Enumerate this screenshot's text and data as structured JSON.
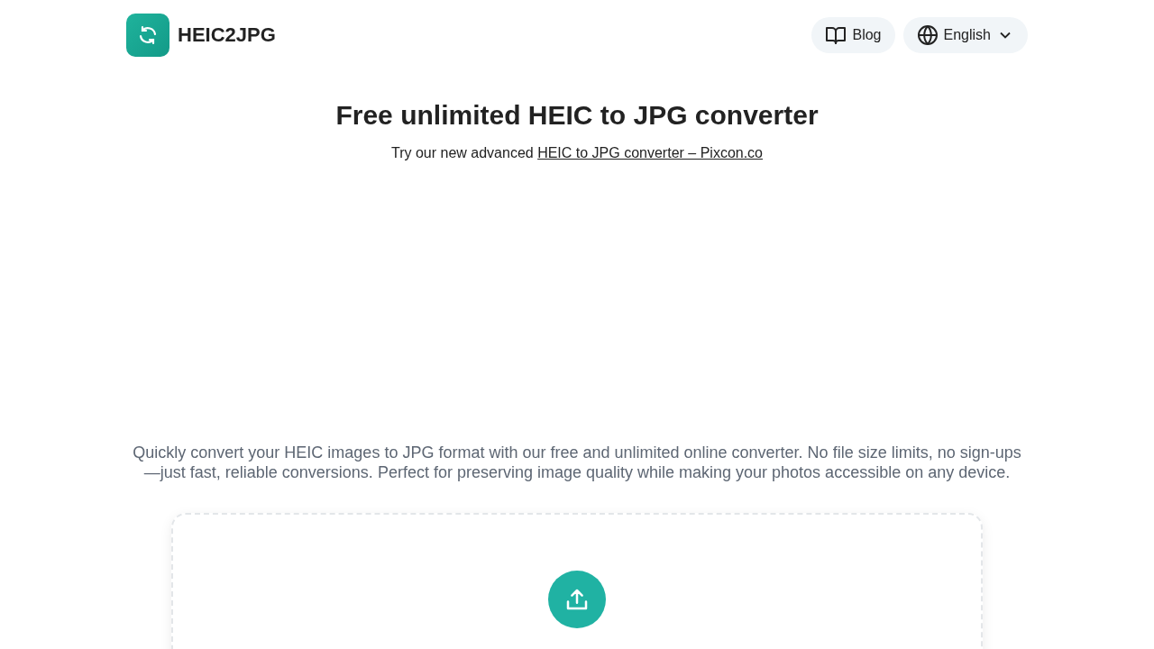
{
  "header": {
    "logo_text": "HEIC2JPG",
    "nav": [
      {
        "kind": "link",
        "label": "Blog"
      },
      {
        "kind": "dropdown",
        "label": "English"
      }
    ]
  },
  "hero": {
    "title": "Free unlimited HEIC to JPG converter",
    "promo_text": "Try our new advanced ",
    "promo_link": "HEIC to JPG converter – Pixcon.co"
  },
  "description": "Quickly convert your HEIC images to JPG format with our free and unlimited online converter. No file size limits, no sign-ups—just fast, reliable conversions. Perfect for preserving image quality while making your photos accessible on any device."
}
